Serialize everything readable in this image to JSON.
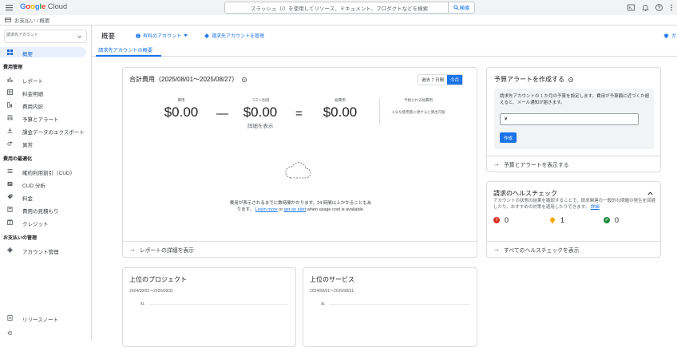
{
  "topbar": {
    "logo": {
      "g1": "G",
      "o1": "o",
      "o2": "o",
      "g2": "g",
      "l": "l",
      "e": "e",
      "cloud": " Cloud"
    },
    "search_placeholder": "スラッシュ（/）を使用してリソース、ドキュメント、プロダクトなどを検索",
    "search_button": "検索",
    "icons": [
      "terminal-icon",
      "bell-icon",
      "help-icon",
      "more-vert-icon"
    ]
  },
  "breadcrumb": {
    "text": "お支払い / 概要"
  },
  "sidebar": {
    "account_label": "請求先アカウント",
    "items_top": [
      {
        "label": "概要",
        "icon": "dashboard-icon",
        "active": true
      }
    ],
    "section_cost_mgmt": "費用管理",
    "cost_items": [
      {
        "label": "レポート",
        "icon": "bar-chart-icon"
      },
      {
        "label": "料金明細",
        "icon": "table-icon"
      },
      {
        "label": "費用内訳",
        "icon": "breakdown-icon"
      },
      {
        "label": "予算とアラート",
        "icon": "budget-icon"
      },
      {
        "label": "課金データのエクスポート",
        "icon": "export-icon"
      },
      {
        "label": "異常",
        "icon": "anomaly-icon"
      }
    ],
    "section_optimization": "費用の最適化",
    "opt_items": [
      {
        "label": "確約利用割引（CUD）",
        "icon": "list-icon"
      },
      {
        "label": "CUD 分析",
        "icon": "analysis-icon"
      },
      {
        "label": "料金",
        "icon": "tag-icon"
      },
      {
        "label": "費用の見積もり",
        "icon": "calculator-icon"
      },
      {
        "label": "クレジット",
        "icon": "credit-icon"
      }
    ],
    "section_payment": "お支払いの管理",
    "pay_items": [
      {
        "label": "アカウント管理",
        "icon": "gear-icon"
      }
    ],
    "release_notes": "リリースノート",
    "collapse": "<|"
  },
  "header": {
    "title": "概要",
    "links": [
      "有料のアカウント",
      "請求先アカウントを管理",
      "ガ"
    ],
    "tab": "請求先アカウントの概要"
  },
  "cost_card": {
    "title": "合計費用（2025/08/01〜2025/08/27）",
    "range_buttons": [
      "過去 7 日間",
      "今月"
    ],
    "metrics": [
      {
        "caption": "費用",
        "value": "$0.00"
      },
      {
        "caption": "コスト削減",
        "value": "$0.00"
      },
      {
        "caption": "総費用",
        "value": "$0.00"
      }
    ],
    "operators": [
      "—",
      "="
    ],
    "details_link": "詳細を表示",
    "forecast_caption": "予想される総費用",
    "forecast_note": "十分な使用量に達すると算出可能",
    "empty_text_1": "費用が表示されるまでに数時間かかります。24 時間以上かかることもあ",
    "empty_text_2a": "ります。",
    "learn_more": "Learn more",
    "or": " or ",
    "get_alert": "get an alert",
    "empty_text_2b": " when usage cost is available.",
    "footer": "レポートの詳細を表示"
  },
  "budget_card": {
    "title": "予算アラートを作成する",
    "description": "請求先アカウントの 1 か月の予算を設定します。費用が予算額に近づくか超えると、メール通知が届きます。",
    "input_value": "¥",
    "create_button": "作成",
    "footer": "予算とアラートを表示する"
  },
  "health_card": {
    "title": "請求のヘルスチェック",
    "description": "アカウントの状態の結果を確認することで、請求関連の一般的な問題の発生を回避したり、おすすめの対策を適用したりできます。",
    "details_link": "詳細",
    "counts": [
      {
        "value": "0",
        "kind": "error",
        "color": "#d93025"
      },
      {
        "value": "1",
        "kind": "warning",
        "color": "#f9ab00"
      },
      {
        "value": "0",
        "kind": "ok",
        "color": "#1e8e3e"
      }
    ],
    "footer": "すべてのヘルスチェックを表示"
  },
  "projects_card": {
    "title": "上位のプロジェクト",
    "date": "2024/08/01〜2025/08/31",
    "tick": "$1"
  },
  "services_card": {
    "title": "上位のサービス",
    "date": "2024/08/01〜2025/08/31",
    "tick": "$1"
  },
  "colors": {
    "accent": "#1a73e8",
    "error": "#d93025",
    "warning": "#f9ab00",
    "ok": "#1e8e3e"
  }
}
